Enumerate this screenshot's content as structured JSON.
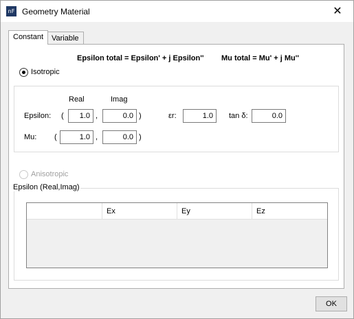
{
  "window": {
    "title": "Geometry Material",
    "icon_text": "nF",
    "close_glyph": "✕"
  },
  "tabs": [
    {
      "label": "Constant",
      "active": true
    },
    {
      "label": "Variable",
      "active": false
    }
  ],
  "formula": {
    "epsilon": "Epsilon total = Epsilon' + j Epsilon''",
    "mu": "Mu total = Mu' + j Mu''"
  },
  "isotropic": {
    "label": "Isotropic",
    "selected": true,
    "col_real": "Real",
    "col_imag": "Imag",
    "epsilon": {
      "label": "Epsilon:",
      "open": "(",
      "comma": ",",
      "close": ")",
      "real": "1.0",
      "imag": "0.0"
    },
    "mu": {
      "label": "Mu:",
      "open": "(",
      "comma": ",",
      "close": ")",
      "real": "1.0",
      "imag": "0.0"
    },
    "er": {
      "label": "εr:",
      "value": "1.0"
    },
    "tand": {
      "label": "tan δ:",
      "value": "0.0"
    }
  },
  "anisotropic": {
    "label": "Anisotropic",
    "selected": false,
    "enabled": false,
    "group_label": "Epsilon (Real,Imag)",
    "columns": [
      "",
      "Ex",
      "Ey",
      "Ez"
    ]
  },
  "buttons": {
    "ok": "OK"
  }
}
